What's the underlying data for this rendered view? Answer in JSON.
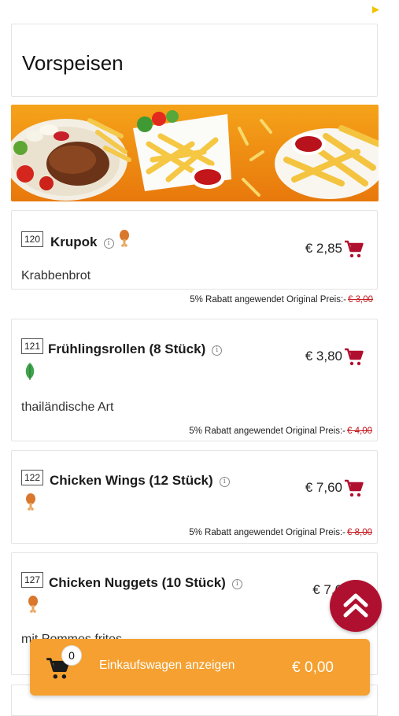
{
  "section": {
    "title": "Vorspeisen"
  },
  "items": [
    {
      "number": "120",
      "name": "Krupok",
      "tag": "chicken-leg-icon",
      "description": "Krabbenbrot",
      "price": "€ 2,85",
      "discount_text": "5% Rabatt angewendet Original Preis:-",
      "original_price": "€ 3,00"
    },
    {
      "number": "121",
      "name": "Frühlingsrollen (8 Stück)",
      "tag": "leaf-icon",
      "description": "thailändische Art",
      "price": "€ 3,80",
      "discount_text": "5% Rabatt angewendet Original Preis:-",
      "original_price": "€ 4,00"
    },
    {
      "number": "122",
      "name": "Chicken Wings (12 Stück)",
      "tag": "chicken-leg-icon",
      "description": "",
      "price": "€ 7,60",
      "discount_text": "5% Rabatt angewendet Original Preis:-",
      "original_price": "€ 8,00"
    },
    {
      "number": "127",
      "name": "Chicken Nuggets (10 Stück)",
      "tag": "chicken-leg-icon",
      "description": "mit Pommes frites",
      "price": "€ 7,6",
      "discount_text": "",
      "original_price": ""
    }
  ],
  "cart": {
    "count": "0",
    "label": "Einkaufswagen anzeigen",
    "total": "€ 0,00"
  },
  "colors": {
    "accent": "#b0102f",
    "cart_bar": "#f5a030",
    "strike": "#c4161c",
    "leaf": "#3fa34d",
    "drumstick": "#d9782d"
  }
}
